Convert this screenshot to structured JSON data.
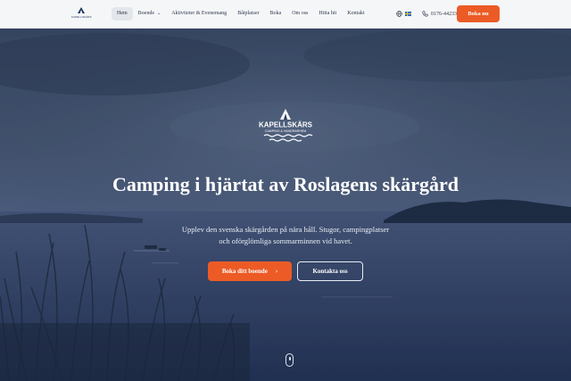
{
  "header": {
    "logo": {
      "name": "kapellskar-logo",
      "text": "KAPELLSKÄRS"
    },
    "nav": [
      {
        "label": "Hem",
        "active": true
      },
      {
        "label": "Boende",
        "has_dropdown": true
      },
      {
        "label": "Aktiviteter & Evenemang"
      },
      {
        "label": "Båtplatser"
      },
      {
        "label": "Boka"
      },
      {
        "label": "Om oss"
      },
      {
        "label": "Hitta hit"
      },
      {
        "label": "Kontakt"
      }
    ],
    "language_icon": "globe-icon",
    "language_flag": "sweden-flag-icon",
    "phone": "0176-44233",
    "book_now_label": "Boka nu"
  },
  "hero": {
    "logo_text": "KAPELLSKÄRS",
    "logo_subtext": "CAMPING & VANDRARHEM",
    "title": "Camping i hjärtat av Roslagens skärgård",
    "subtitle_line1": "Upplev den svenska skärgården på nära håll. Stugor, campingplatser",
    "subtitle_line2": "och oförglömliga sommarminnen vid havet.",
    "primary_button": "Boka ditt boende",
    "secondary_button": "Kontakta oss"
  },
  "colors": {
    "accent": "#ec5b26",
    "navy": "#1d3461",
    "header_bg": "#f5f6f8"
  }
}
